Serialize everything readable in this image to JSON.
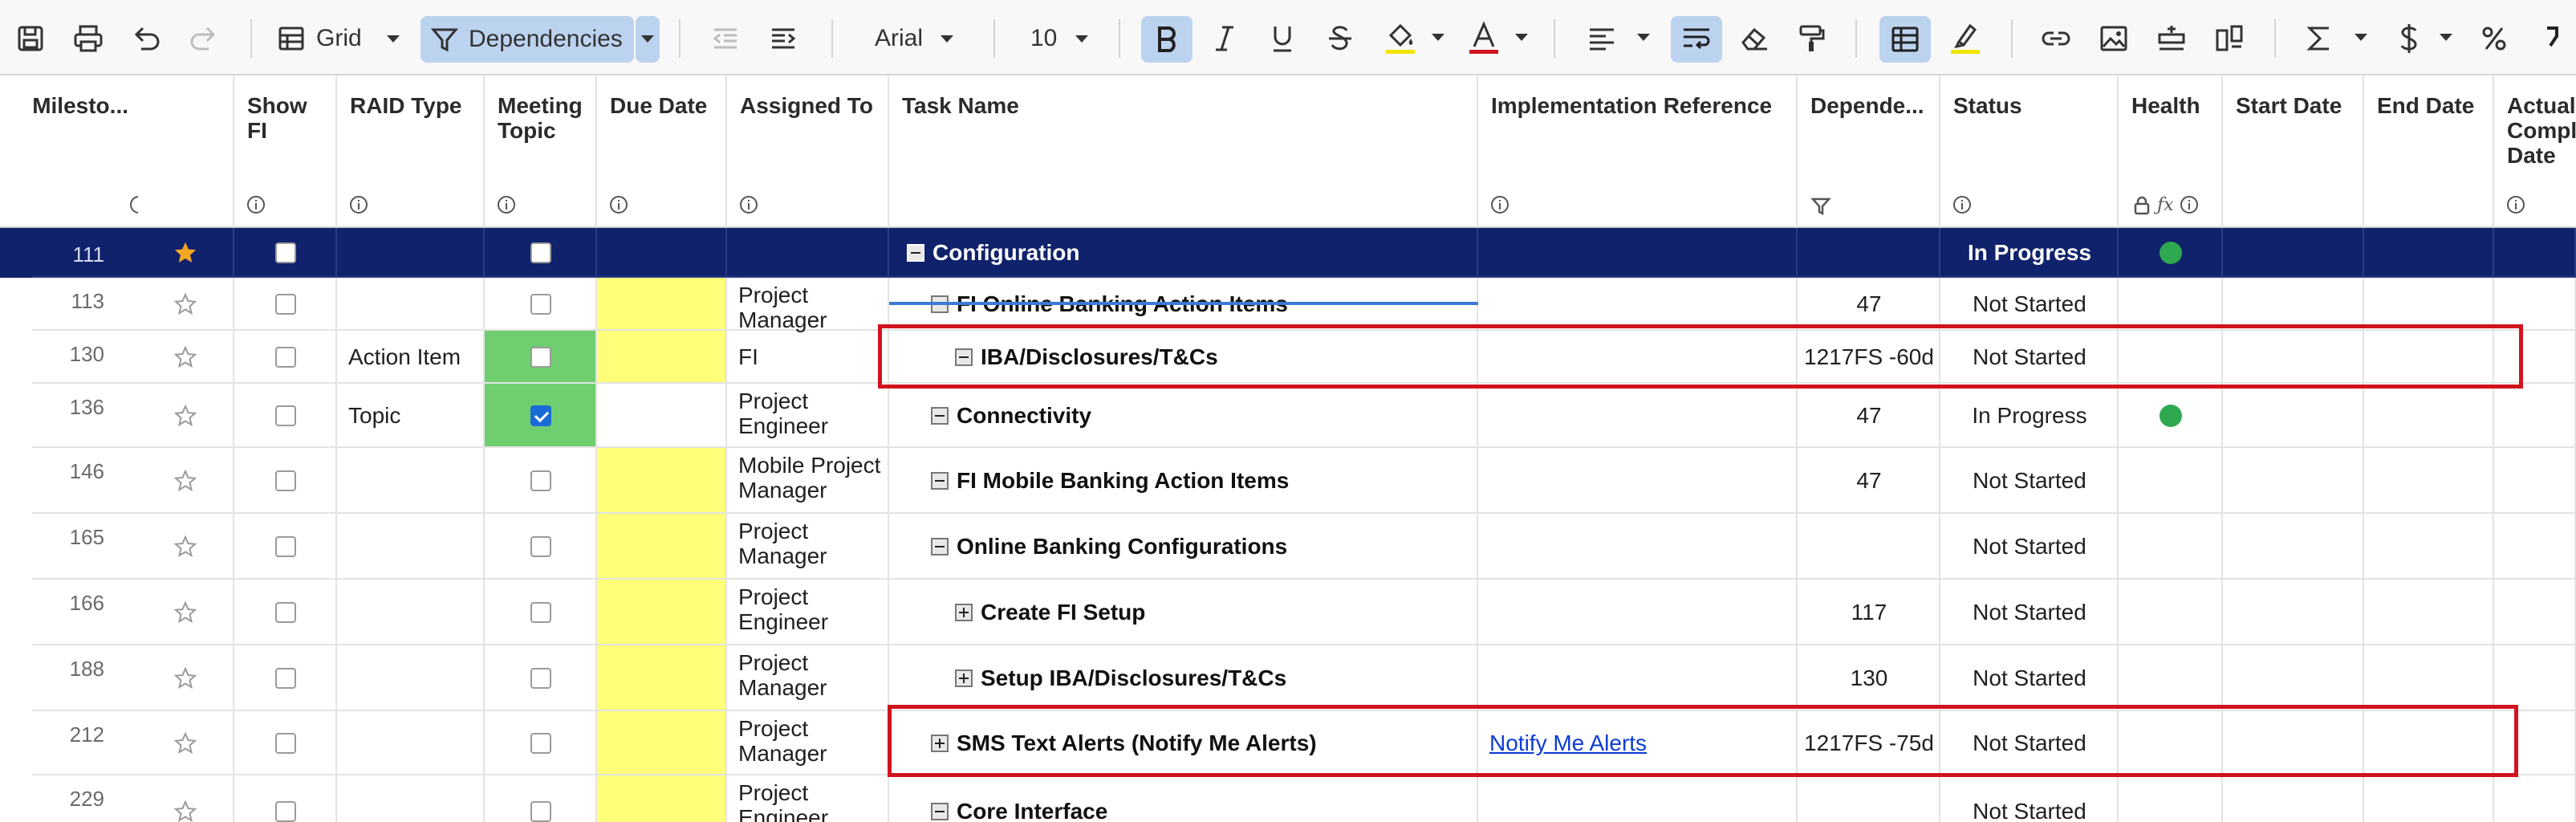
{
  "toolbar": {
    "view_label": "Grid",
    "filter_label": "Dependencies",
    "font_name": "Arial",
    "font_size": "10",
    "icons": [
      "save-icon",
      "print-icon",
      "undo-icon",
      "redo-icon",
      "grid-view-icon",
      "filter-icon",
      "outdent-icon",
      "indent-icon",
      "bold-icon",
      "italic-icon",
      "underline-icon",
      "strikethrough-icon",
      "fill-color-icon",
      "text-color-icon",
      "align-icon",
      "wrap-text-icon",
      "eraser-icon",
      "format-painter-icon",
      "gridlines-icon",
      "highlight-icon",
      "link-icon",
      "image-icon",
      "insert-row-icon",
      "card-icon",
      "sum-icon",
      "currency-icon",
      "percent-icon"
    ],
    "colors": {
      "active": "#bcd3ef",
      "fill_underline": "#f2e600",
      "text_underline": "#d0141f"
    }
  },
  "columns": [
    {
      "label": "Milesto...",
      "icon": "dependency-icon"
    },
    {
      "label": "Show FI",
      "icon": "info-icon"
    },
    {
      "label": "RAID Type",
      "icon": "info-icon"
    },
    {
      "label": "Meeting Topic",
      "icon": "info-icon"
    },
    {
      "label": "Due Date",
      "icon": "info-icon"
    },
    {
      "label": "Assigned To",
      "icon": "info-icon"
    },
    {
      "label": "Task Name",
      "icon": ""
    },
    {
      "label": "Implementation Reference",
      "icon": "info-icon"
    },
    {
      "label": "Depende...",
      "icon": "filter-icon"
    },
    {
      "label": "Status",
      "icon": "info-icon"
    },
    {
      "label": "Health",
      "icon": "lock-formula-info-icons"
    },
    {
      "label": "Start Date",
      "icon": ""
    },
    {
      "label": "End Date",
      "icon": ""
    },
    {
      "label": "Actual Compl Date",
      "icon": "info-icon"
    }
  ],
  "rows": [
    {
      "num": "111",
      "raid": "",
      "assigned": "",
      "task": "Configuration",
      "impl": "",
      "dep": "",
      "status": "In Progress",
      "health": "green",
      "due_yellow": false,
      "meeting": "header"
    },
    {
      "num": "113",
      "raid": "",
      "assigned": "Project Manager",
      "task": "FI Online Banking Action Items",
      "impl": "",
      "dep": "47",
      "status": "Not Started",
      "health": "",
      "due_yellow": true,
      "meeting": "unchecked"
    },
    {
      "num": "130",
      "raid": "Action Item",
      "assigned": "FI",
      "task": "IBA/Disclosures/T&Cs",
      "impl": "",
      "dep": "1217FS -60d",
      "status": "Not Started",
      "health": "",
      "due_yellow": true,
      "meeting": "green-unchecked"
    },
    {
      "num": "136",
      "raid": "Topic",
      "assigned": "Project Engineer",
      "task": "Connectivity",
      "impl": "",
      "dep": "47",
      "status": "In Progress",
      "health": "green",
      "due_yellow": false,
      "meeting": "green-checked"
    },
    {
      "num": "146",
      "raid": "",
      "assigned": "Mobile Project Manager",
      "task": "FI Mobile Banking Action Items",
      "impl": "",
      "dep": "47",
      "status": "Not Started",
      "health": "",
      "due_yellow": true,
      "meeting": "unchecked"
    },
    {
      "num": "165",
      "raid": "",
      "assigned": "Project Manager",
      "task": "Online Banking Configurations",
      "impl": "",
      "dep": "",
      "status": "Not Started",
      "health": "",
      "due_yellow": true,
      "meeting": "unchecked"
    },
    {
      "num": "166",
      "raid": "",
      "assigned": "Project Engineer",
      "task": "Create FI Setup",
      "impl": "",
      "dep": "117",
      "status": "Not Started",
      "health": "",
      "due_yellow": true,
      "meeting": "unchecked"
    },
    {
      "num": "188",
      "raid": "",
      "assigned": "Project Manager",
      "task": "Setup IBA/Disclosures/T&Cs",
      "impl": "",
      "dep": "130",
      "status": "Not Started",
      "health": "",
      "due_yellow": true,
      "meeting": "unchecked"
    },
    {
      "num": "212",
      "raid": "",
      "assigned": "Project Manager",
      "task": "SMS Text Alerts (Notify Me Alerts)",
      "impl": "Notify Me Alerts",
      "dep": "1217FS -75d",
      "status": "Not Started",
      "health": "",
      "due_yellow": true,
      "meeting": "unchecked"
    },
    {
      "num": "229",
      "raid": "",
      "assigned": "Project Engineer",
      "task": "Core Interface",
      "impl": "",
      "dep": "",
      "status": "Not Started",
      "health": "",
      "due_yellow": true,
      "meeting": "unchecked"
    }
  ],
  "theme": {
    "header_row_bg": "#10226b",
    "health_green": "#2fa94f",
    "highlight_red": "#d0141f",
    "due_yellow": "#ffff79",
    "meeting_green": "#6fce6f"
  }
}
